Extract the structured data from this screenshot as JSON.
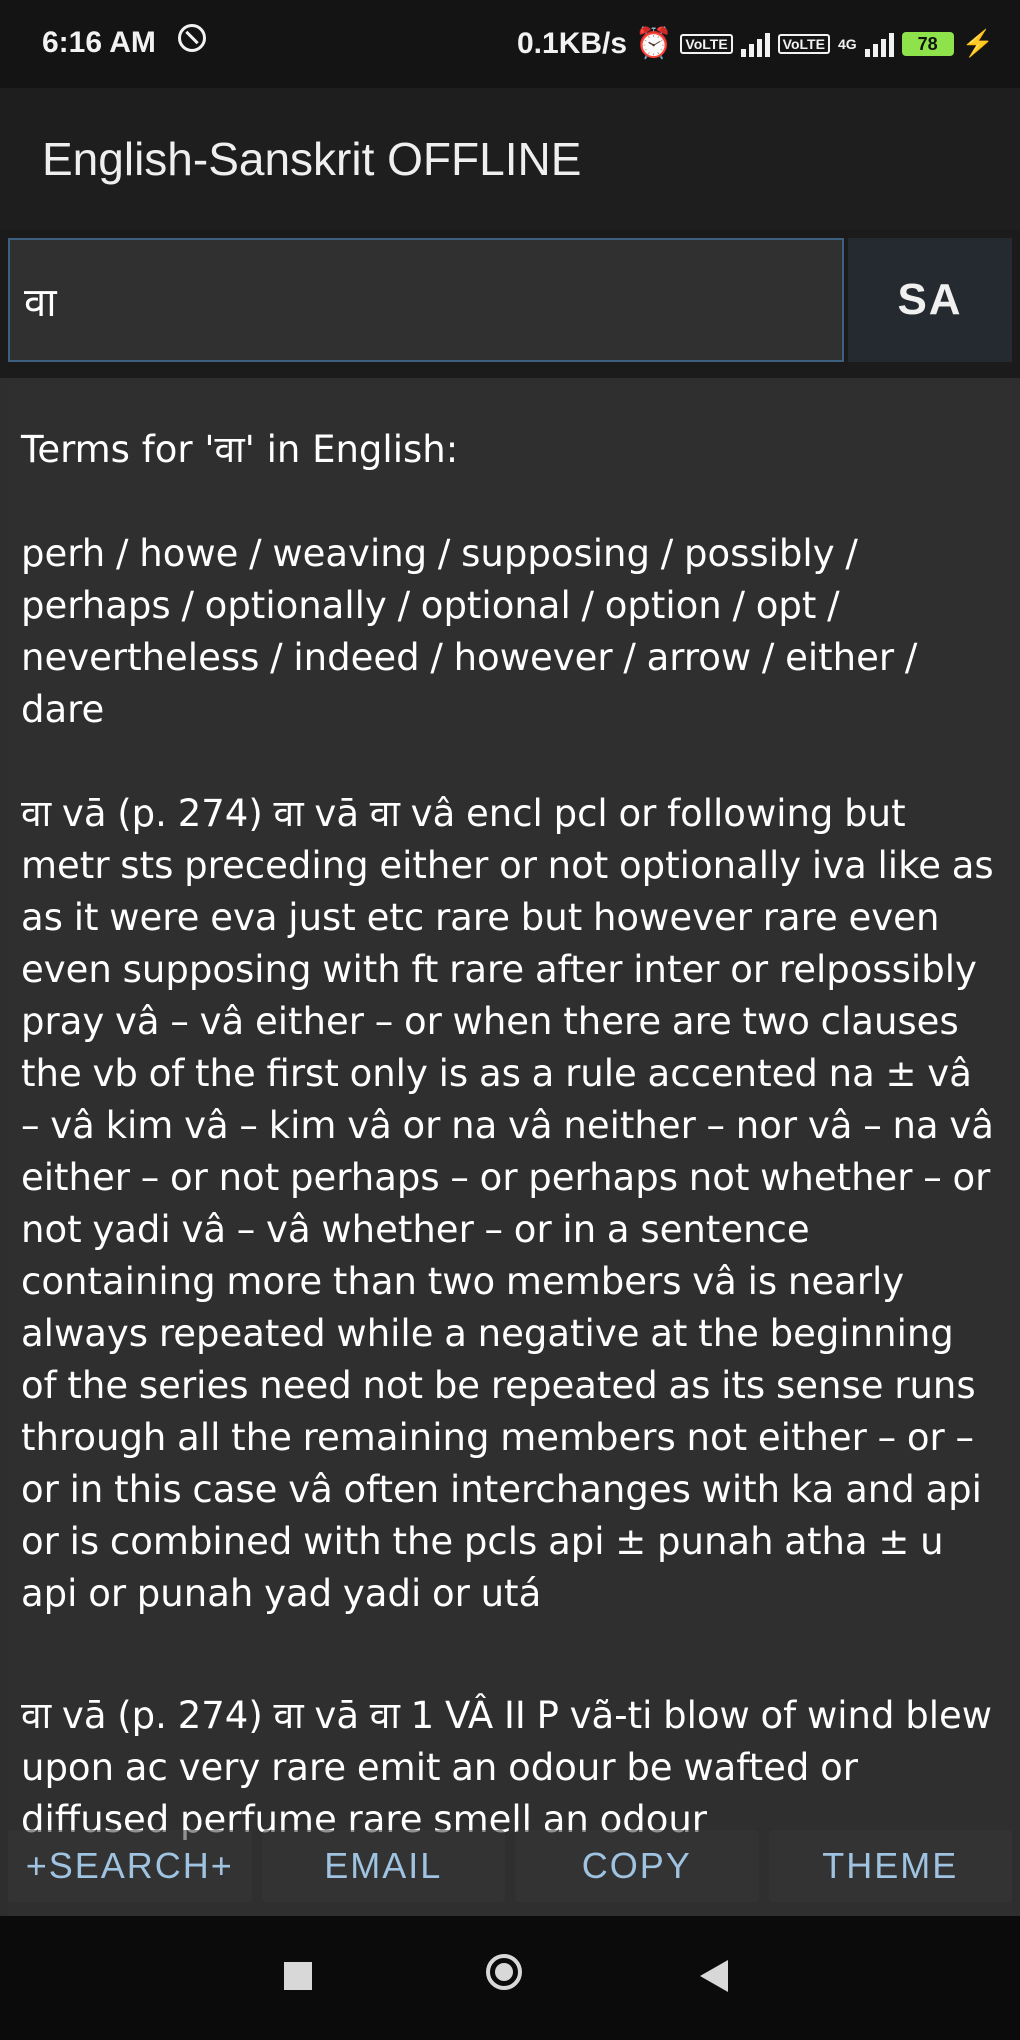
{
  "status_bar": {
    "time": "6:16 AM",
    "net_speed": "0.1KB/s",
    "volte": "VoLTE",
    "network_type": "4G",
    "battery": "78",
    "battery_color": "#8ee34a"
  },
  "app_bar": {
    "title": "English-Sanskrit OFFLINE"
  },
  "search": {
    "value": "वा",
    "lang_button": "SA"
  },
  "result": {
    "heading": "Terms for 'वा' in English:",
    "terms": "perh / howe / weaving / supposing / possibly / perhaps / optionally / optional / option / opt / nevertheless / indeed / however / arrow / either / dare",
    "entry1": "वा vā (p. 274) वा vā वा vâ encl pcl or following but metr sts preceding either or not optionally iva like as as it were eva just etc rare but however rare even even supposing with ft rare after inter or relpossibly pray vâ – vâ either – or when there are two clauses the vb of the first only is as a rule accented na ± vâ – vâ kim vâ – kim vâ or na vâ neither – nor vâ – na vâ either – or not perhaps – or perhaps not whether – or not yadi vâ – vâ whether – or in a sentence containing more than two members vâ is nearly always repeated while a negative at the beginning of the series need not be repeated as its sense runs through all the remaining members not either – or – or in this case vâ often interchanges with ka and api or is combined with the pcls api ± punah atha ± u api or punah yad yadi or utá",
    "entry2": "वा vā (p. 274) वा vā वा 1 VÂ II P vã-ti blow of wind blew upon ac very rare emit an odour be wafted or diffused perfume rare smell an odour"
  },
  "buttons": {
    "search": "+SEARCH+",
    "email": "EMAIL",
    "copy": "COPY",
    "theme": "THEME"
  },
  "colors": {
    "background": "#2e2e2e",
    "text": "#ffffff",
    "button_text": "#9fc3e0",
    "input_border": "#3d5f80"
  }
}
